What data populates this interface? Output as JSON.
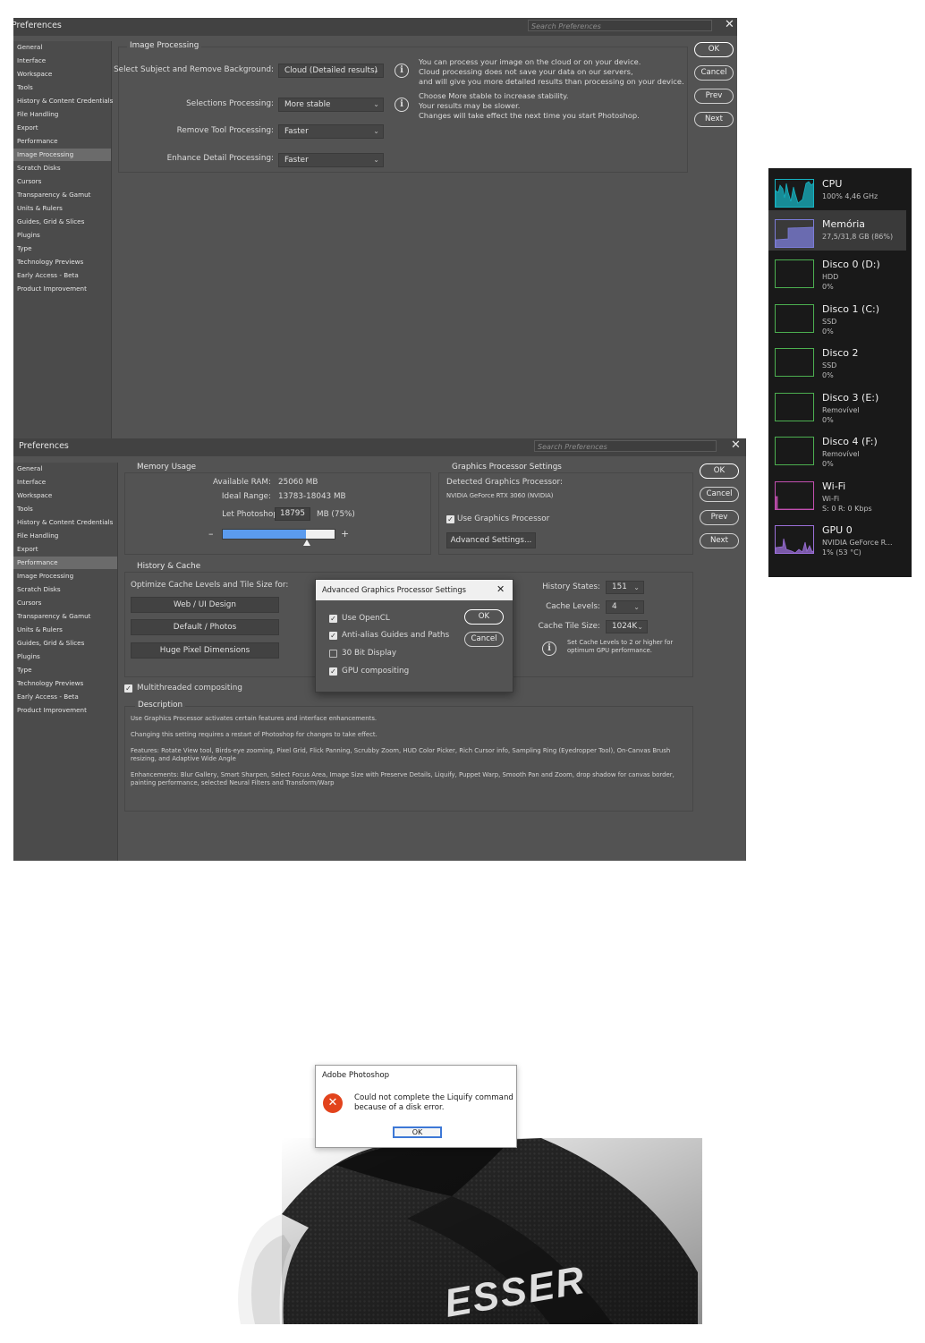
{
  "search_placeholder": "Search Preferences",
  "win1": {
    "title": "Preferences",
    "sidebar": [
      "General",
      "Interface",
      "Workspace",
      "Tools",
      "History & Content Credentials",
      "File Handling",
      "Export",
      "Performance",
      "Image Processing",
      "Scratch Disks",
      "Cursors",
      "Transparency & Gamut",
      "Units & Rulers",
      "Guides, Grid & Slices",
      "Plugins",
      "Type",
      "Technology Previews",
      "Early Access - Beta",
      "Product Improvement"
    ],
    "active_index": 8,
    "group_title": "Image Processing",
    "rows": [
      {
        "label": "Select Subject and Remove Background:",
        "value": "Cloud (Detailed results)"
      },
      {
        "label": "Selections Processing:",
        "value": "More stable"
      },
      {
        "label": "Remove Tool Processing:",
        "value": "Faster"
      },
      {
        "label": "Enhance Detail Processing:",
        "value": "Faster"
      }
    ],
    "info1": [
      "You can process your image on the cloud or on your device.",
      "Cloud processing does not save your data on our servers,",
      "and will give you more detailed results than processing on your device."
    ],
    "info2": [
      "Choose More stable to increase stability.",
      "Your results may be slower.",
      "Changes will take effect the next time you start Photoshop."
    ],
    "buttons": {
      "ok": "OK",
      "cancel": "Cancel",
      "prev": "Prev",
      "next": "Next"
    }
  },
  "win2": {
    "title": "Preferences",
    "sidebar": [
      "General",
      "Interface",
      "Workspace",
      "Tools",
      "History & Content Credentials",
      "File Handling",
      "Export",
      "Performance",
      "Image Processing",
      "Scratch Disks",
      "Cursors",
      "Transparency & Gamut",
      "Units & Rulers",
      "Guides, Grid & Slices",
      "Plugins",
      "Type",
      "Technology Previews",
      "Early Access - Beta",
      "Product Improvement"
    ],
    "active_index": 7,
    "memory": {
      "title": "Memory Usage",
      "available_label": "Available RAM:",
      "available_value": "25060 MB",
      "ideal_label": "Ideal Range:",
      "ideal_value": "13783-18043 MB",
      "let_label": "Let Photoshop Use:",
      "let_value": "18795",
      "let_unit": "MB (75%)",
      "slider_fraction": 0.75,
      "minus": "–",
      "plus": "+"
    },
    "gpu": {
      "title": "Graphics Processor Settings",
      "detected_label": "Detected Graphics Processor:",
      "detected_value": "NVIDIA GeForce RTX 3060 (NVIDIA)",
      "use_label": "Use Graphics Processor",
      "advanced_button": "Advanced Settings..."
    },
    "history": {
      "title": "History & Cache",
      "optimize_label": "Optimize Cache Levels and Tile Size for:",
      "buttons": [
        "Web / UI Design",
        "Default / Photos",
        "Huge Pixel Dimensions"
      ],
      "states_label": "History States:",
      "states_value": "151",
      "levels_label": "Cache Levels:",
      "levels_value": "4",
      "tile_label": "Cache Tile Size:",
      "tile_value": "1024K",
      "note": [
        "Set Cache Levels to 2 or higher for",
        "optimum GPU performance."
      ]
    },
    "multithreaded": "Multithreaded compositing",
    "description": {
      "title": "Description",
      "p1": "Use Graphics Processor activates certain features and interface enhancements.",
      "p2": "Changing this setting requires a restart of Photoshop for changes to take effect.",
      "p3": "Features: Rotate View tool, Birds-eye zooming, Pixel Grid, Flick Panning, Scrubby Zoom, HUD Color Picker, Rich Cursor info, Sampling Ring (Eyedropper Tool), On-Canvas Brush resizing, and Adaptive Wide Angle",
      "p4": "Enhancements: Blur Gallery, Smart Sharpen, Select Focus Area, Image Size with Preserve Details, Liquify, Puppet Warp, Smooth Pan and Zoom, drop shadow for canvas border, painting performance, selected Neural Filters and Transform/Warp"
    },
    "buttons": {
      "ok": "OK",
      "cancel": "Cancel",
      "prev": "Prev",
      "next": "Next"
    }
  },
  "advanced_dialog": {
    "title": "Advanced Graphics Processor Settings",
    "options": [
      {
        "label": "Use OpenCL",
        "checked": true
      },
      {
        "label": "Anti-alias Guides and Paths",
        "checked": true
      },
      {
        "label": "30 Bit Display",
        "checked": false
      },
      {
        "label": "GPU compositing",
        "checked": true
      }
    ],
    "ok": "OK",
    "cancel": "Cancel"
  },
  "task_manager": [
    {
      "name": "CPU",
      "lines": [
        "100% 4,46 GHz"
      ],
      "color": "#17b3c2"
    },
    {
      "name": "Memória",
      "lines": [
        "27,5/31,8 GB (86%)"
      ],
      "color": "#7b7cd8"
    },
    {
      "name": "Disco 0 (D:)",
      "lines": [
        "HDD",
        "0%"
      ],
      "color": "#4caf50"
    },
    {
      "name": "Disco 1 (C:)",
      "lines": [
        "SSD",
        "0%"
      ],
      "color": "#4caf50"
    },
    {
      "name": "Disco 2",
      "lines": [
        "SSD",
        "0%"
      ],
      "color": "#4caf50"
    },
    {
      "name": "Disco 3 (E:)",
      "lines": [
        "Removível",
        "0%"
      ],
      "color": "#4caf50"
    },
    {
      "name": "Disco 4 (F:)",
      "lines": [
        "Removível",
        "0%"
      ],
      "color": "#4caf50"
    },
    {
      "name": "Wi-Fi",
      "lines": [
        "Wi-Fi",
        "S: 0 R: 0 Kbps"
      ],
      "color": "#c24fb0"
    },
    {
      "name": "GPU 0",
      "lines": [
        "NVIDIA GeForce R...",
        "1% (53 °C)"
      ],
      "color": "#9b6fd8"
    }
  ],
  "error_dialog": {
    "title": "Adobe Photoshop",
    "message": [
      "Could not complete the Liquify command",
      "because of a disk error."
    ],
    "ok": "OK"
  },
  "shoe_logo": "ESSER"
}
